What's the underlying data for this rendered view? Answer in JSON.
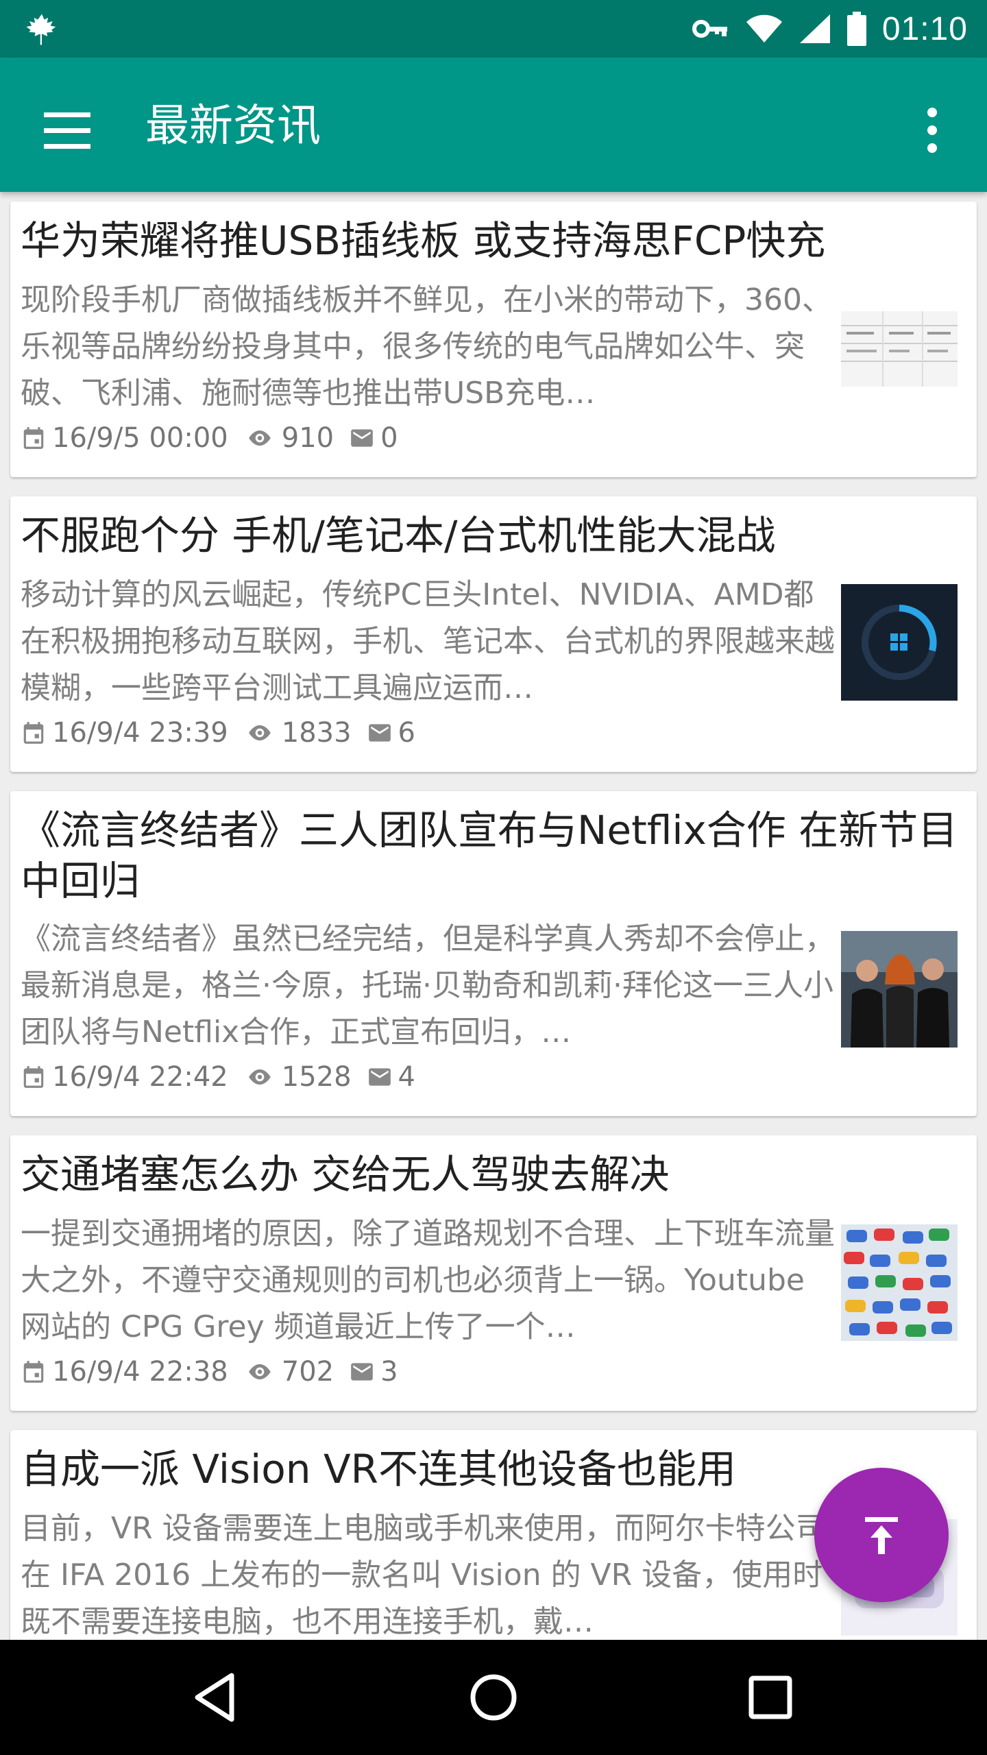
{
  "status_bar": {
    "time": "01:10",
    "icons": [
      "leaf-icon",
      "key-icon",
      "wifi-icon",
      "signal-icon",
      "battery-icon"
    ]
  },
  "app_bar": {
    "title": "最新资讯",
    "menu_icon": "hamburger-menu-icon",
    "more_icon": "more-vertical-icon",
    "background": "#009688"
  },
  "articles": [
    {
      "title": "华为荣耀将推USB插线板 或支持海思FCP快充",
      "summary": "现阶段手机厂商做插线板并不鲜见，在小米的带动下，360、乐视等品牌纷纷投身其中，很多传统的电气品牌如公牛、突破、飞利浦、施耐德等也推出带USB充电…",
      "date": "16/9/5 00:00",
      "views": "910",
      "comments": "0",
      "thumbnail": "document-table-thumbnail"
    },
    {
      "title": "不服跑个分 手机/笔记本/台式机性能大混战",
      "summary": "移动计算的风云崛起，传统PC巨头Intel、NVIDIA、AMD都在积极拥抱移动互联网，手机、笔记本、台式机的界限越来越模糊，一些跨平台测试工具遍应运而…",
      "date": "16/9/4 23:39",
      "views": "1833",
      "comments": "6",
      "thumbnail": "benchmark-ring-thumbnail"
    },
    {
      "title": "《流言终结者》三人团队宣布与Netflix合作 在新节目中回归",
      "summary": "《流言终结者》虽然已经完结，但是科学真人秀却不会停止，最新消息是，格兰·今原，托瑞·贝勒奇和凯莉·拜伦这一三人小团队将与Netflix合作，正式宣布回归，…",
      "date": "16/9/4 22:42",
      "views": "1528",
      "comments": "4",
      "thumbnail": "three-people-photo-thumbnail"
    },
    {
      "title": "交通堵塞怎么办 交给无人驾驶去解决",
      "summary": "一提到交通拥堵的原因，除了道路规划不合理、上下班车流量大之外，不遵守交通规则的司机也必须背上一锅。Youtube 网站的 CPG Grey 频道最近上传了一个…",
      "date": "16/9/4 22:38",
      "views": "702",
      "comments": "3",
      "thumbnail": "traffic-cars-thumbnail"
    },
    {
      "title": "自成一派 Vision VR不连其他设备也能用",
      "summary": "目前，VR 设备需要连上电脑或手机来使用，而阿尔卡特公司在 IFA 2016 上发布的一款名叫 Vision 的 VR 设备，使用时既不需要连接电脑，也不用连接手机，戴…",
      "date": "",
      "views": "",
      "comments": "",
      "thumbnail": "vr-headset-thumbnail"
    }
  ],
  "fab": {
    "icon": "scroll-to-top-icon",
    "color": "#9c27b0"
  },
  "nav_bar": {
    "icons": [
      "back-icon",
      "home-icon",
      "recents-icon"
    ]
  }
}
